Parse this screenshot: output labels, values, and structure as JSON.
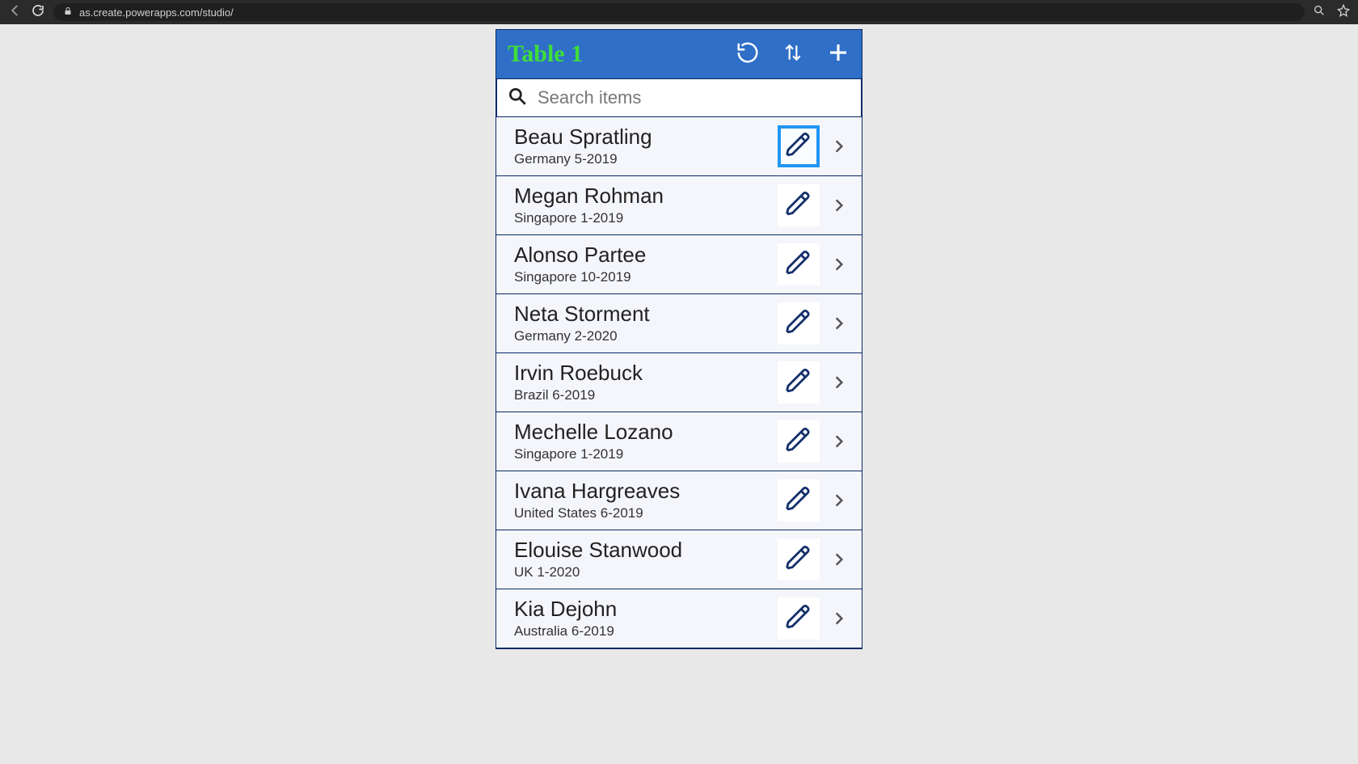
{
  "browser": {
    "url": "as.create.powerapps.com/studio/"
  },
  "app": {
    "title": "Table 1",
    "search_placeholder": "Search items"
  },
  "rows": [
    {
      "name": "Beau Spratling",
      "sub": "Germany 5-2019",
      "selected": true
    },
    {
      "name": "Megan Rohman",
      "sub": "Singapore 1-2019",
      "selected": false
    },
    {
      "name": "Alonso Partee",
      "sub": "Singapore 10-2019",
      "selected": false
    },
    {
      "name": "Neta Storment",
      "sub": "Germany 2-2020",
      "selected": false
    },
    {
      "name": "Irvin Roebuck",
      "sub": "Brazil 6-2019",
      "selected": false
    },
    {
      "name": "Mechelle Lozano",
      "sub": "Singapore 1-2019",
      "selected": false
    },
    {
      "name": "Ivana Hargreaves",
      "sub": "United States 6-2019",
      "selected": false
    },
    {
      "name": "Elouise Stanwood",
      "sub": "UK 1-2020",
      "selected": false
    },
    {
      "name": "Kia Dejohn",
      "sub": "Australia 6-2019",
      "selected": false
    }
  ],
  "colors": {
    "header_bg": "#2f6fc7",
    "title_green": "#3fdd3b",
    "selection_blue": "#2196f3",
    "ink": "#14306b"
  }
}
